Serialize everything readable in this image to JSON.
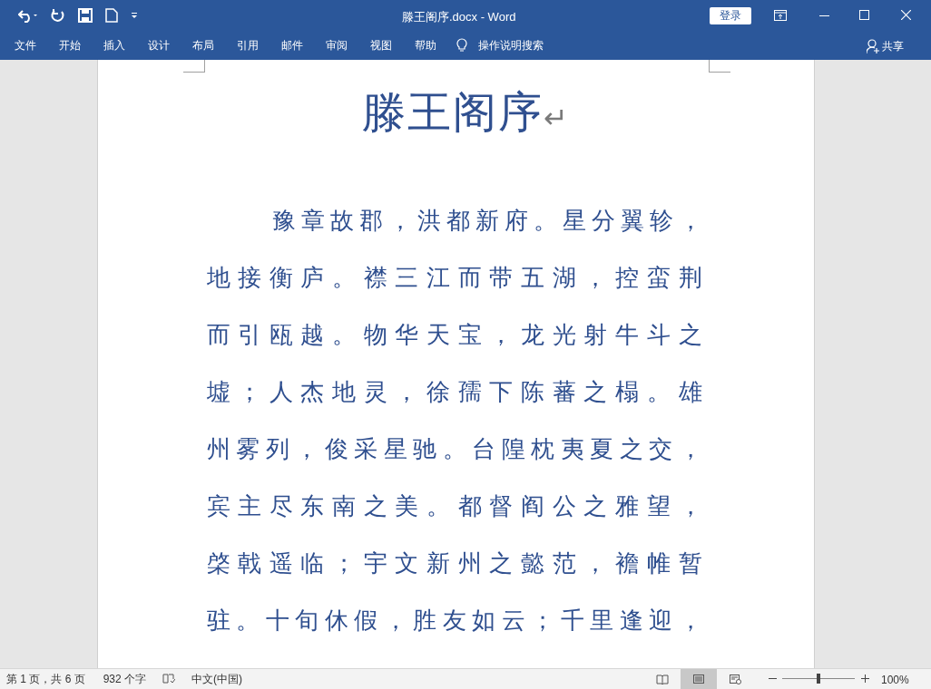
{
  "window": {
    "title": "滕王阁序.docx  -  Word",
    "login": "登录"
  },
  "ribbon_tabs": [
    {
      "label": "文件",
      "selected": false
    },
    {
      "label": "开始",
      "selected": false
    },
    {
      "label": "插入",
      "selected": false
    },
    {
      "label": "设计",
      "selected": false
    },
    {
      "label": "布局",
      "selected": false
    },
    {
      "label": "引用",
      "selected": false
    },
    {
      "label": "邮件",
      "selected": false
    },
    {
      "label": "审阅",
      "selected": false
    },
    {
      "label": "视图",
      "selected": false
    },
    {
      "label": "帮助",
      "selected": false
    }
  ],
  "tell_me": "操作说明搜索",
  "share": "共享",
  "document": {
    "title": "滕王阁序",
    "paragraph_mark": "↵",
    "lines": [
      "豫章故郡，洪都新府。星分翼轸，",
      "地接衡庐。襟三江而带五湖，控蛮荆",
      "而引瓯越。物华天宝，龙光射牛斗之",
      "墟；人杰地灵，徐孺下陈蕃之榻。雄",
      "州雾列，俊采星驰。台隍枕夷夏之交，",
      "宾主尽东南之美。都督阎公之雅望，",
      "棨戟遥临；宇文新州之懿范，襜帷暂",
      "驻。十旬休假，胜友如云；千里逢迎，"
    ]
  },
  "status_bar": {
    "page": "第 1 页，共 6 页",
    "words": "932 个字",
    "language": "中文(中国)",
    "views": [
      {
        "kind": "read",
        "selected": false
      },
      {
        "kind": "print",
        "selected": true
      },
      {
        "kind": "web",
        "selected": false
      }
    ],
    "zoom": {
      "level": 0.5,
      "reading": "100%"
    }
  }
}
